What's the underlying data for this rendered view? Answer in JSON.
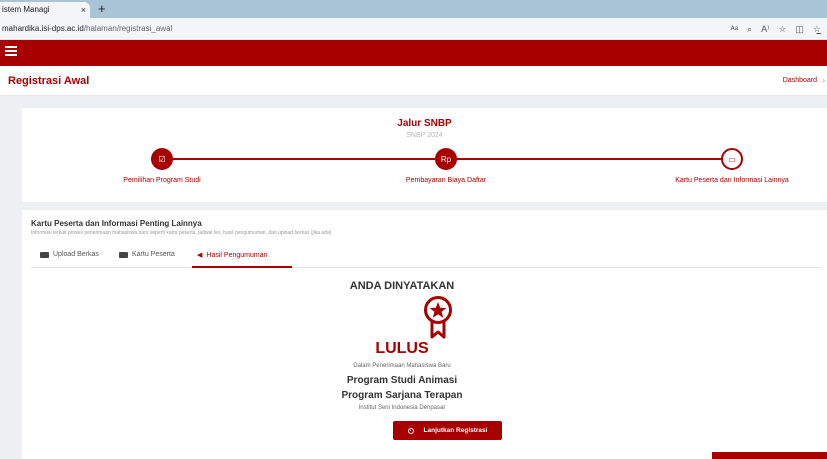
{
  "browser": {
    "tab_title": "istem Managi",
    "tab_close": "×",
    "new_tab": "+",
    "url_host": "mahardika.isi-dps.ac.id",
    "url_path": "/halaman/registrasi_awal",
    "icons": [
      "translate-icon",
      "zoom-icon",
      "read-aloud-icon",
      "favorite-icon",
      "split-screen-icon",
      "collections-icon"
    ]
  },
  "header": {
    "page_title": "Registrasi Awal",
    "breadcrumb": "Dashboard",
    "breadcrumb_sep": "›"
  },
  "steps_card": {
    "title": "Jalur SNBP",
    "subtitle": "SNBP 2024",
    "steps": [
      {
        "label": "Pemilihan Program Studi",
        "icon": "check-square-icon",
        "glyph": "☑"
      },
      {
        "label": "Pembayaran Biaya Daftar",
        "icon": "rupiah-icon",
        "glyph": "Rp"
      },
      {
        "label": "Kartu Peserta dan Informasi Lainnya",
        "icon": "card-icon",
        "glyph": "▭"
      }
    ]
  },
  "info_card": {
    "title": "Kartu Peserta dan Informasi Penting Lainnya",
    "description": "Informasi terkait proses penerimaan mahasiswa baru seperti kartu peserta, jadwal tes, hasil pengumuman, dan upload berkas (jika ada)",
    "tabs": [
      {
        "label": "Upload Berkas",
        "icon": "id-card-icon"
      },
      {
        "label": "Kartu Peserta",
        "icon": "id-card-icon"
      },
      {
        "label": "Hasil Pengumuman",
        "icon": "bullhorn-icon",
        "active": true
      }
    ],
    "result": {
      "heading": "ANDA DINYATAKAN",
      "status": "LULUS",
      "context": "Dalam Penerimaan Mahasiswa Baru",
      "prodi": "Program Studi Animasi",
      "program": "Program Sarjana Terapan",
      "institution": "Institut Seni Indonesia Denpasar",
      "button_label": "Lanjutkan Registrasi"
    }
  },
  "colors": {
    "brand": "#a80000",
    "background": "#eef0f4"
  }
}
